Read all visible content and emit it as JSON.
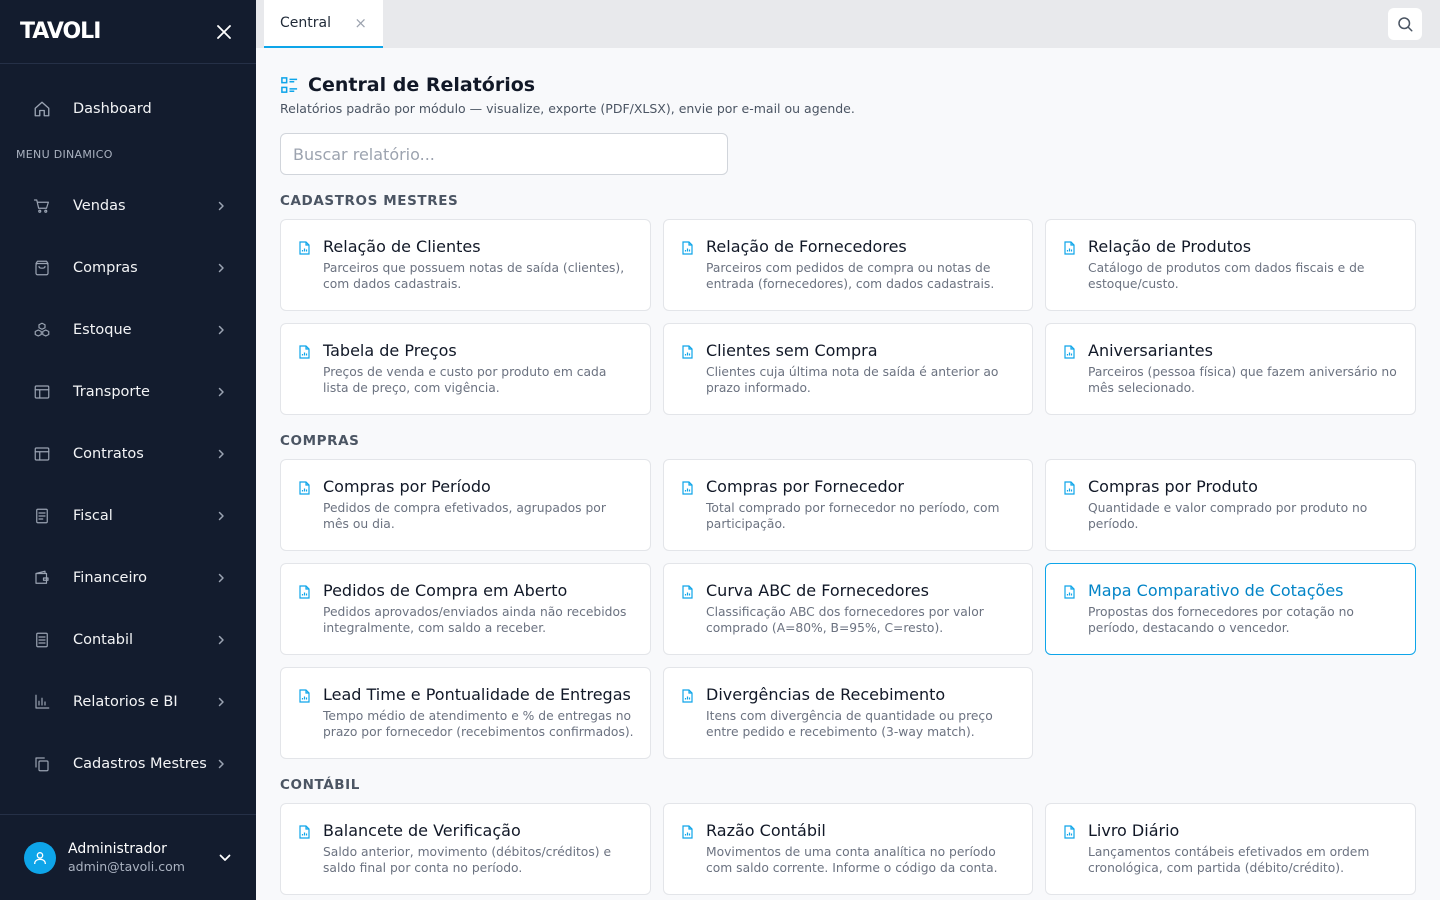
{
  "sidebar": {
    "logo": "TAVOLI",
    "dashboard_label": "Dashboard",
    "section_label": "MENU DINAMICO",
    "items": [
      {
        "label": "Vendas"
      },
      {
        "label": "Compras"
      },
      {
        "label": "Estoque"
      },
      {
        "label": "Transporte"
      },
      {
        "label": "Contratos"
      },
      {
        "label": "Fiscal"
      },
      {
        "label": "Financeiro"
      },
      {
        "label": "Contabil"
      },
      {
        "label": "Relatorios e BI"
      },
      {
        "label": "Cadastros Mestres"
      }
    ],
    "user": {
      "name": "Administrador",
      "email": "admin@tavoli.com"
    }
  },
  "tabs": [
    {
      "label": "Central",
      "close": "×"
    }
  ],
  "main": {
    "title": "Central de Relatórios",
    "subtitle": "Relatórios padrão por módulo — visualize, exporte (PDF/XLSX), envie por e-mail ou agende.",
    "search_placeholder": "Buscar relatório...",
    "categories": [
      {
        "title": "CADASTROS MESTRES",
        "reports": [
          {
            "title": "Relação de Clientes",
            "desc": "Parceiros que possuem notas de saída (clientes), com dados cadastrais."
          },
          {
            "title": "Relação de Fornecedores",
            "desc": "Parceiros com pedidos de compra ou notas de entrada (fornecedores), com dados cadastrais."
          },
          {
            "title": "Relação de Produtos",
            "desc": "Catálogo de produtos com dados fiscais e de estoque/custo."
          },
          {
            "title": "Tabela de Preços",
            "desc": "Preços de venda e custo por produto em cada lista de preço, com vigência."
          },
          {
            "title": "Clientes sem Compra",
            "desc": "Clientes cuja última nota de saída é anterior ao prazo informado."
          },
          {
            "title": "Aniversariantes",
            "desc": "Parceiros (pessoa física) que fazem aniversário no mês selecionado."
          }
        ]
      },
      {
        "title": "COMPRAS",
        "reports": [
          {
            "title": "Compras por Período",
            "desc": "Pedidos de compra efetivados, agrupados por mês ou dia."
          },
          {
            "title": "Compras por Fornecedor",
            "desc": "Total comprado por fornecedor no período, com participação."
          },
          {
            "title": "Compras por Produto",
            "desc": "Quantidade e valor comprado por produto no período."
          },
          {
            "title": "Pedidos de Compra em Aberto",
            "desc": "Pedidos aprovados/enviados ainda não recebidos integralmente, com saldo a receber."
          },
          {
            "title": "Curva ABC de Fornecedores",
            "desc": "Classificação ABC dos fornecedores por valor comprado (A=80%, B=95%, C=resto)."
          },
          {
            "title": "Mapa Comparativo de Cotações",
            "desc": "Propostas dos fornecedores por cotação no período, destacando o vencedor."
          },
          {
            "title": "Lead Time e Pontualidade de Entregas",
            "desc": "Tempo médio de atendimento e % de entregas no prazo por fornecedor (recebimentos confirmados)."
          },
          {
            "title": "Divergências de Recebimento",
            "desc": "Itens com divergência de quantidade ou preço entre pedido e recebimento (3-way match)."
          }
        ]
      },
      {
        "title": "CONTÁBIL",
        "reports": [
          {
            "title": "Balancete de Verificação",
            "desc": "Saldo anterior, movimento (débitos/créditos) e saldo final por conta no período."
          },
          {
            "title": "Razão Contábil",
            "desc": "Movimentos de uma conta analítica no período com saldo corrente. Informe o código da conta."
          },
          {
            "title": "Livro Diário",
            "desc": "Lançamentos contábeis efetivados em ordem cronológica, com partida (débito/crédito)."
          }
        ]
      }
    ]
  },
  "colors": {
    "sidebar_bg": "#131c2e",
    "accent": "#0ea5e9",
    "avatar_bg": "#0ea5e9"
  }
}
